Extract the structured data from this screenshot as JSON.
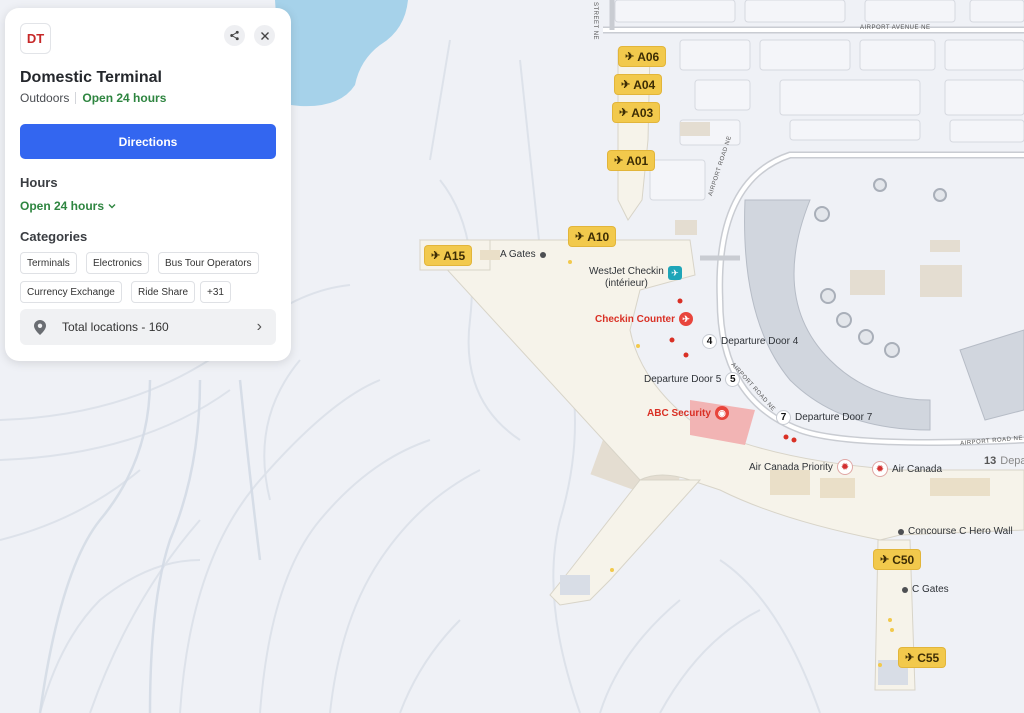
{
  "panel": {
    "logo_text": "DT",
    "share_icon": "share-icon",
    "close_icon": "close-icon",
    "title": "Domestic Terminal",
    "category": "Outdoors",
    "status": "Open 24 hours",
    "directions_label": "Directions",
    "hours_heading": "Hours",
    "hours_value": "Open 24 hours",
    "categories_heading": "Categories",
    "chips": [
      "Terminals",
      "Electronics",
      "Bus Tour Operators",
      "Currency Exchange",
      "Ride Share",
      "+31"
    ],
    "total_locations": "Total locations - 160",
    "colors": {
      "accent": "#3366f0",
      "open": "#2e8540",
      "logo": "#c62828"
    }
  },
  "map": {
    "gates": [
      "A06",
      "A04",
      "A03",
      "A01",
      "A10",
      "A15",
      "C50",
      "C55"
    ],
    "labels": {
      "a_gates": "A Gates",
      "westjet": "WestJet Checkin",
      "westjet_sub": "(intérieur)",
      "checkin_counter": "Checkin Counter",
      "door4": "Departure Door 4",
      "door5": "Departure Door 5",
      "door7": "Departure Door 7",
      "abc_security": "ABC Security",
      "ac_priority": "Air Canada Priority",
      "air_canada": "Air Canada",
      "c_hero_wall": "Concourse C Hero Wall",
      "c_gates": "C Gates",
      "door4_num": "4",
      "door5_num": "5",
      "door7_num": "7",
      "badge13": "13",
      "badge13_text": "Depa"
    },
    "roads": {
      "airport_avenue": "AIRPORT AVENUE NE",
      "street": "STREET NE",
      "airport_road_1": "AIRPORT ROAD NE",
      "airport_road_2": "AIRPORT ROAD NE",
      "airport_road_3": "AIRPORT ROAD NE"
    },
    "colors": {
      "gate": "#f2c94c",
      "water": "#a6d2ea",
      "land": "#eff1f6",
      "terminal": "#f6f3ea",
      "security": "#f2b4b4"
    }
  }
}
